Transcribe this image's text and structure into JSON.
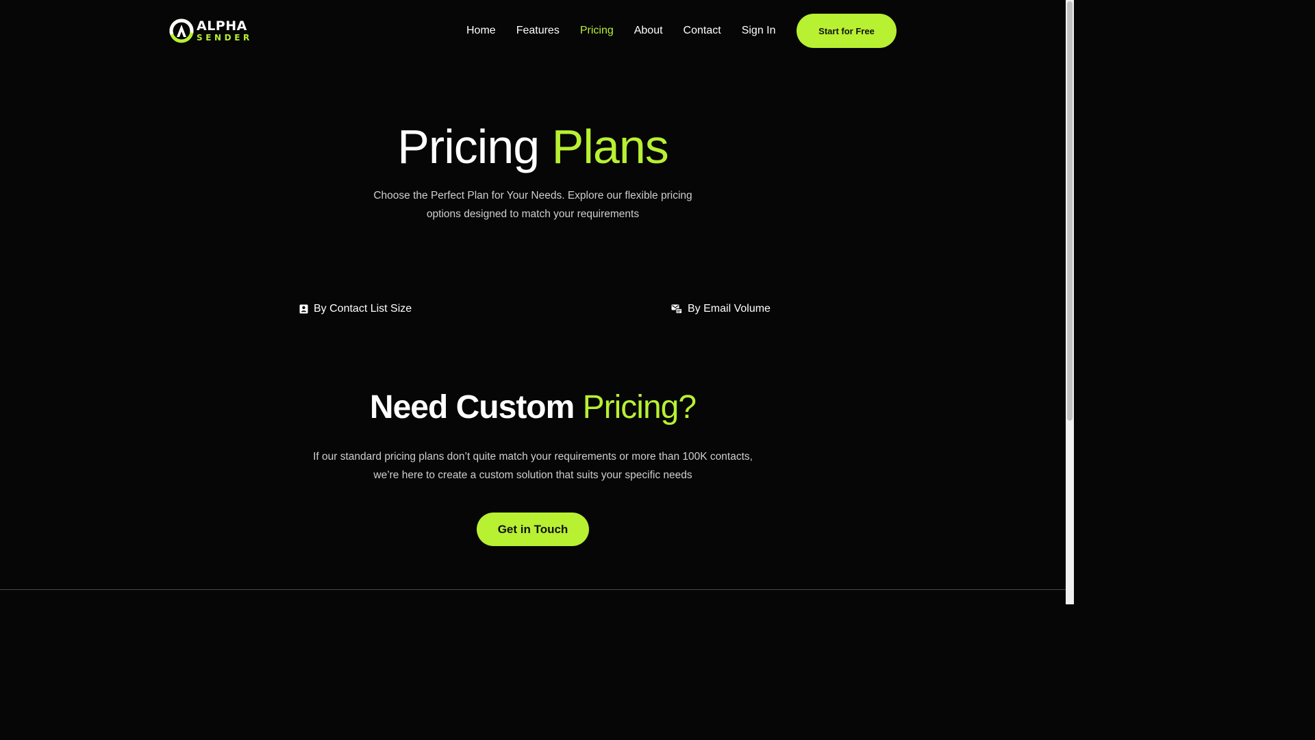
{
  "brand": {
    "logo_top": "ALPHA",
    "logo_bottom": "SENDER",
    "accent_color": "#b8f032",
    "background_color": "#060606"
  },
  "nav": {
    "items": [
      {
        "label": "Home",
        "active": false
      },
      {
        "label": "Features",
        "active": false
      },
      {
        "label": "Pricing",
        "active": true
      },
      {
        "label": "About",
        "active": false
      },
      {
        "label": "Contact",
        "active": false
      },
      {
        "label": "Sign In",
        "active": false
      }
    ],
    "cta_label": "Start for Free"
  },
  "hero": {
    "title_main": "Pricing",
    "title_accent": "Plans",
    "subtitle": "Choose the Perfect Plan for Your Needs. Explore our flexible pricing options designed to match your requirements"
  },
  "tabs": {
    "contact": {
      "label": "By Contact List Size",
      "icon": "contact-card-icon"
    },
    "email": {
      "label": "By Email Volume",
      "icon": "email-volume-icon"
    }
  },
  "custom": {
    "title_main": "Need Custom",
    "title_accent": "Pricing?",
    "subtitle": "If our standard pricing plans don’t quite match your requirements or more than 100K contacts, we’re here to create a custom solution that suits your specific needs",
    "cta_label": "Get in Touch"
  }
}
